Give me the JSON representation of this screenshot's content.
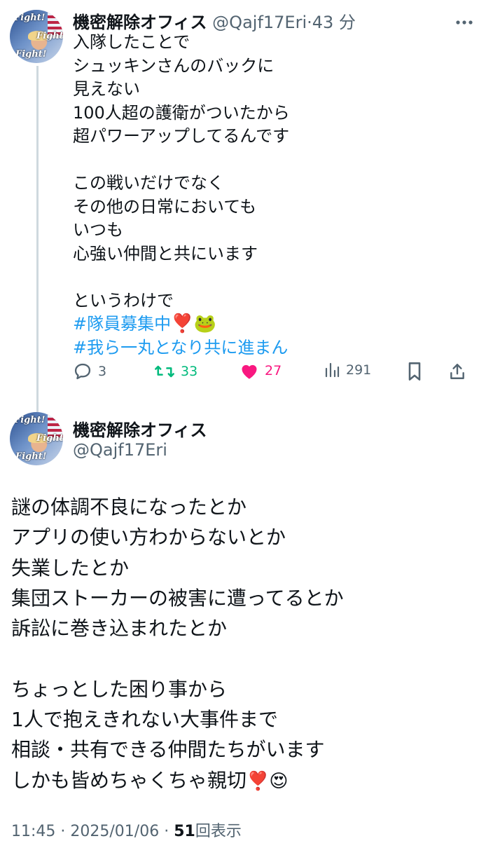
{
  "tweet1": {
    "avatar_text": [
      "Fight!",
      "Fight!",
      "Fight!"
    ],
    "display_name": "機密解除オフィス",
    "handle": "@Qajf17Eri",
    "separator": "·",
    "time": "43 分",
    "more_icon": "more-dots",
    "text": "入隊したことで\nシュッキンさんのバックに\n見えない\n100人超の護衛がついたから\n超パワーアップしてるんです\n\nこの戦いだけでなく\nその他の日常においても\nいつも\n心強い仲間と共にいます\n\nというわけで",
    "hashtag1": "#隊員募集中",
    "hashtag1_emoji": "❣️🐸",
    "hashtag2": "#我ら一丸となり共に進まん",
    "actions": {
      "reply_count": "3",
      "retweet_count": "33",
      "like_count": "27",
      "views_count": "291"
    },
    "colors": {
      "retweet": "#00ba7c",
      "like": "#f91880",
      "link": "#1d9bf0",
      "muted": "#536471"
    }
  },
  "tweet2": {
    "avatar_text": [
      "Fight!",
      "Fight!",
      "Fight!"
    ],
    "display_name": "機密解除オフィス",
    "handle": "@Qajf17Eri",
    "text": "謎の体調不良になったとか\nアプリの使い方わからないとか\n失業したとか\n集団ストーカーの被害に遭ってるとか\n訴訟に巻き込まれたとか\n\nちょっとした困り事から\n1人で抱えきれない大事件まで\n相談・共有できる仲間たちがいます\nしかも皆めちゃくちゃ親切",
    "text_emoji": "❣️😍",
    "meta": {
      "time": "11:45",
      "separator": "·",
      "date": "2025/01/06",
      "separator2": "·",
      "views_count": "51",
      "views_label": "回表示"
    }
  }
}
